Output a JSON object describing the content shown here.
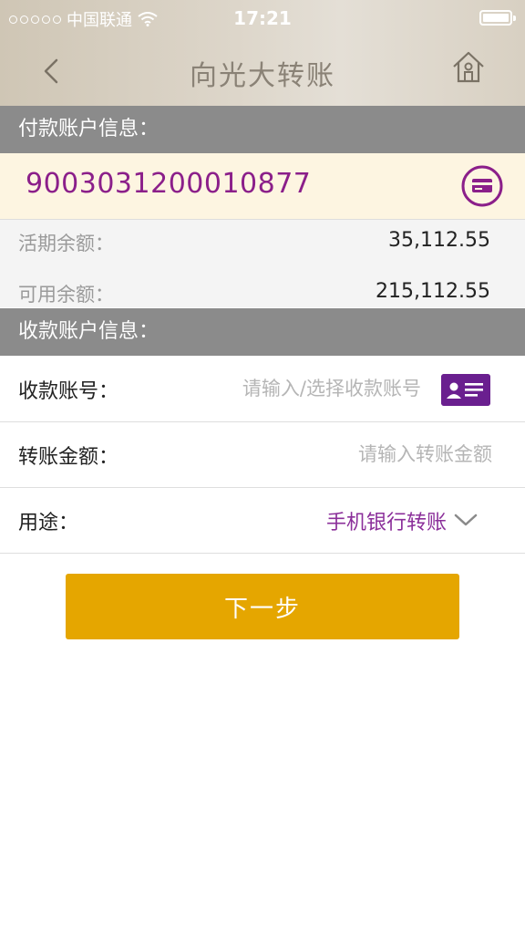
{
  "status_bar": {
    "carrier": "中国联通",
    "time": "17:21"
  },
  "nav": {
    "title": "向光大转账"
  },
  "payer": {
    "section_title": "付款账户信息：",
    "account_number": "9003031200010877",
    "current_balance_label": "活期余额：",
    "current_balance": "35,112.55",
    "available_balance_label": "可用余额：",
    "available_balance": "215,112.55"
  },
  "payee": {
    "section_title": "收款账户信息：",
    "account_label": "收款账号：",
    "account_placeholder": "请输入/选择收款账号",
    "amount_label": "转账金额：",
    "amount_placeholder": "请输入转账金额",
    "purpose_label": "用途：",
    "purpose_value": "手机银行转账"
  },
  "actions": {
    "next_label": "下一步"
  },
  "colors": {
    "accent_purple": "#8b1f8a",
    "button_gold": "#e5a600",
    "section_gray": "#8b8b8b",
    "account_bg": "#fdf5e1"
  }
}
